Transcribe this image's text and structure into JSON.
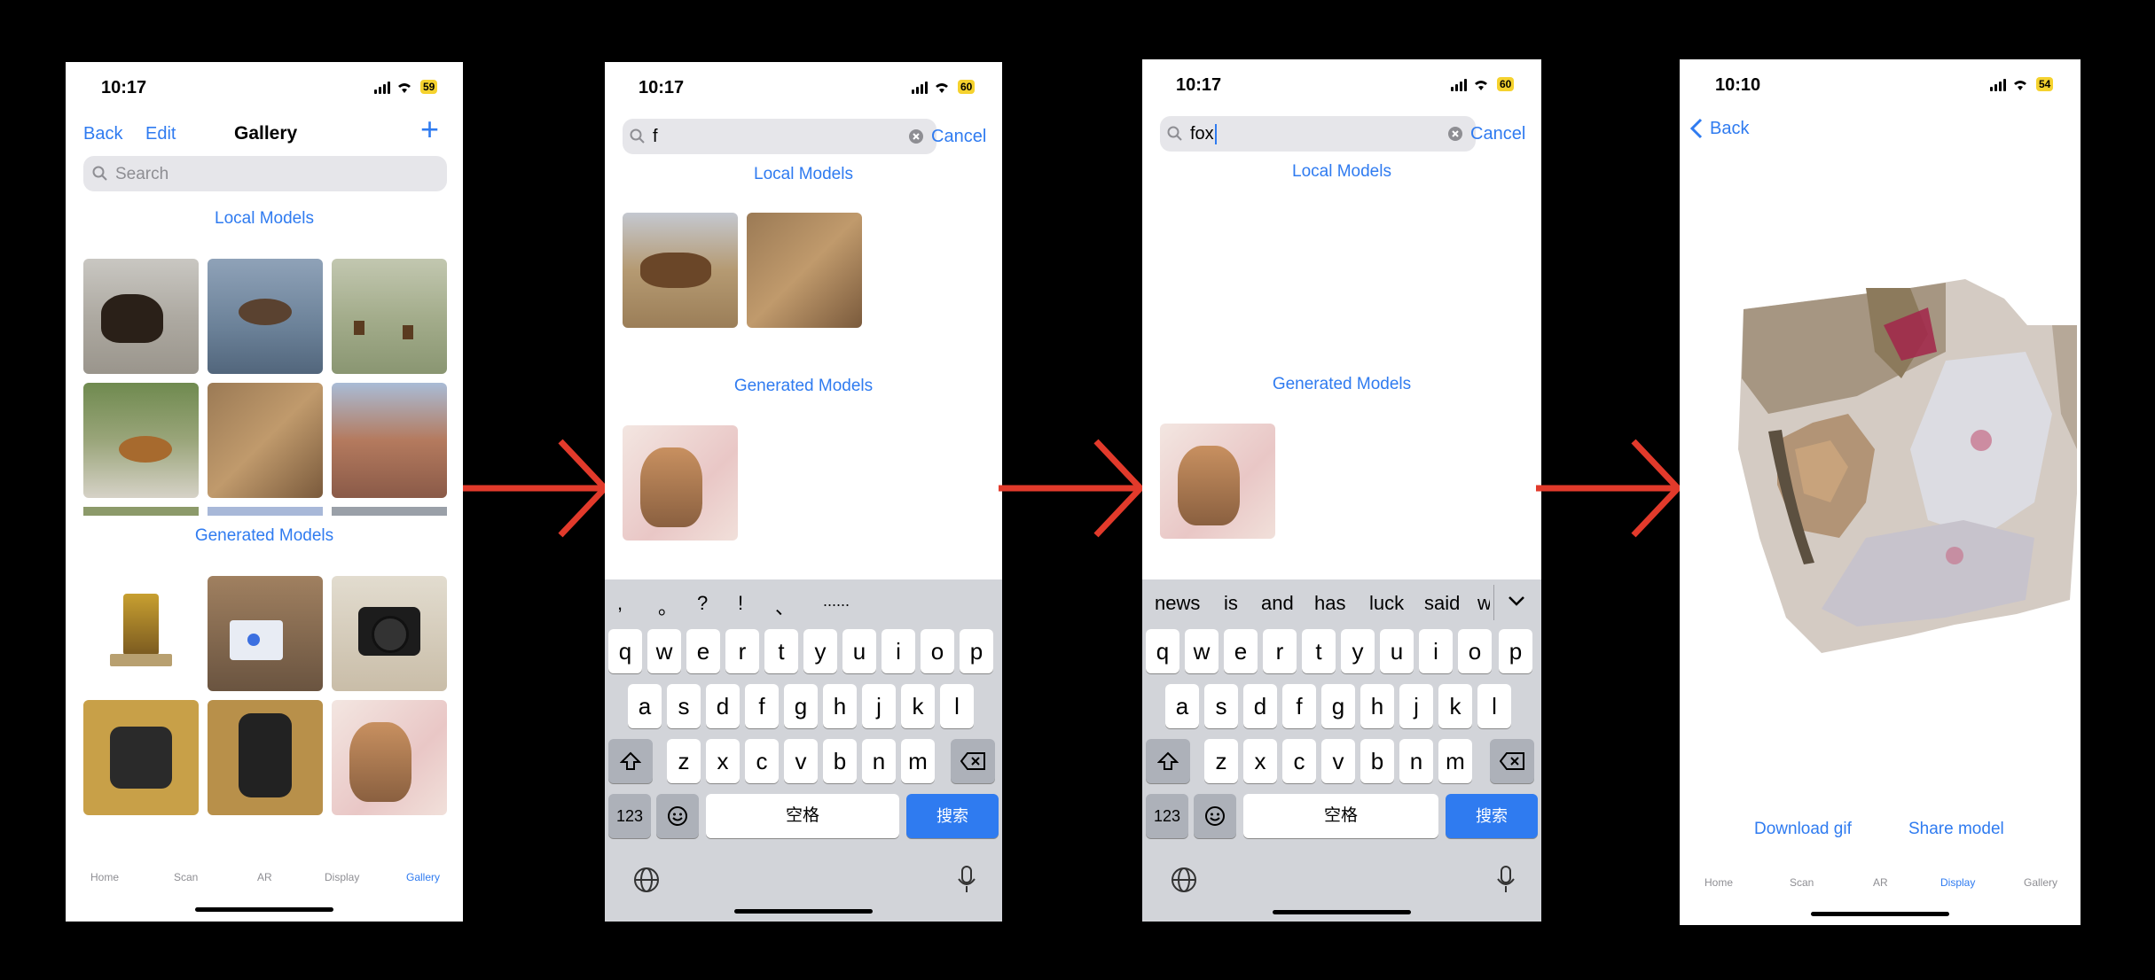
{
  "screen1": {
    "time": "10:17",
    "battery": "59",
    "nav": {
      "back": "Back",
      "edit": "Edit",
      "title": "Gallery",
      "add": "+"
    },
    "search_placeholder": "Search",
    "local_title": "Local Models",
    "generated_title": "Generated Models",
    "tabs": [
      "Home",
      "Scan",
      "AR",
      "Display",
      "Gallery"
    ],
    "active_tab": "Gallery"
  },
  "screen2": {
    "time": "10:17",
    "battery": "60",
    "search_value": "f",
    "cancel": "Cancel",
    "local_title": "Local Models",
    "generated_title": "Generated Models",
    "suggestions": [
      ",",
      "。",
      "?",
      "!",
      "、",
      "......"
    ],
    "space_label": "空格",
    "search_key": "搜索",
    "numbers_key": "123"
  },
  "screen3": {
    "time": "10:17",
    "battery": "60",
    "search_value": "fox",
    "cancel": "Cancel",
    "local_title": "Local Models",
    "generated_title": "Generated Models",
    "suggestions": [
      "news",
      "is",
      "and",
      "has",
      "luck",
      "said",
      "w"
    ],
    "space_label": "空格",
    "search_key": "搜索",
    "numbers_key": "123"
  },
  "screen4": {
    "time": "10:10",
    "battery": "54",
    "back": "Back",
    "download": "Download gif",
    "share": "Share model",
    "tabs": [
      "Home",
      "Scan",
      "AR",
      "Display",
      "Gallery"
    ],
    "active_tab": "Display"
  },
  "keyboard": {
    "row1": [
      "q",
      "w",
      "e",
      "r",
      "t",
      "y",
      "u",
      "i",
      "o",
      "p"
    ],
    "row2": [
      "a",
      "s",
      "d",
      "f",
      "g",
      "h",
      "j",
      "k",
      "l"
    ],
    "row3": [
      "z",
      "x",
      "c",
      "v",
      "b",
      "n",
      "m"
    ]
  },
  "colors": {
    "accent": "#2f7bf0",
    "arrow": "#e23a2b",
    "battery": "#f5d22e"
  }
}
